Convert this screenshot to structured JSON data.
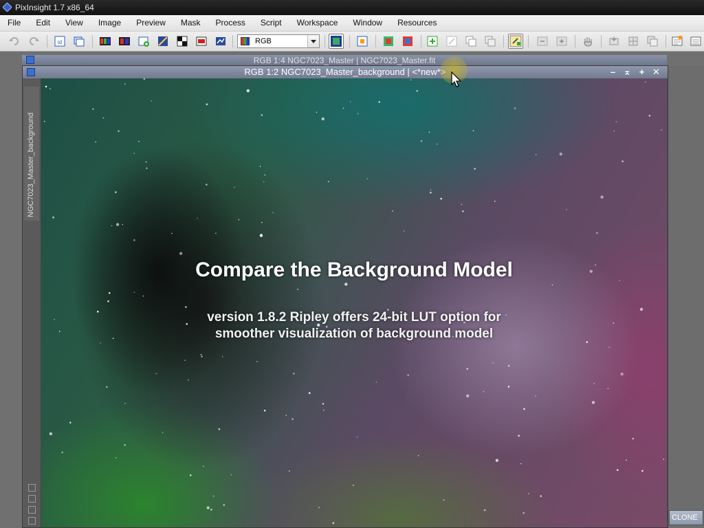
{
  "app": {
    "title": "PixInsight 1.7 x86_64"
  },
  "menu": [
    "File",
    "Edit",
    "View",
    "Image",
    "Preview",
    "Mask",
    "Process",
    "Script",
    "Workspace",
    "Window",
    "Resources"
  ],
  "toolbar": {
    "channel_select_value": "RGB"
  },
  "windows": {
    "back_title": "RGB 1:4 NGC7023_Master | NGC7023_Master.fit",
    "front_title": "RGB 1:2 NGC7023_Master_background | <*new*>",
    "side_tab_label": "NGC7023_Master_background",
    "controls": [
      "–",
      "⌅",
      "+",
      "✕"
    ]
  },
  "overlay": {
    "title": "Compare the Background Model",
    "subtitle_line1": "version 1.8.2 Ripley offers 24-bit LUT option for",
    "subtitle_line2": "smoother visualization of background model"
  },
  "clone": {
    "label": "CLONE"
  }
}
